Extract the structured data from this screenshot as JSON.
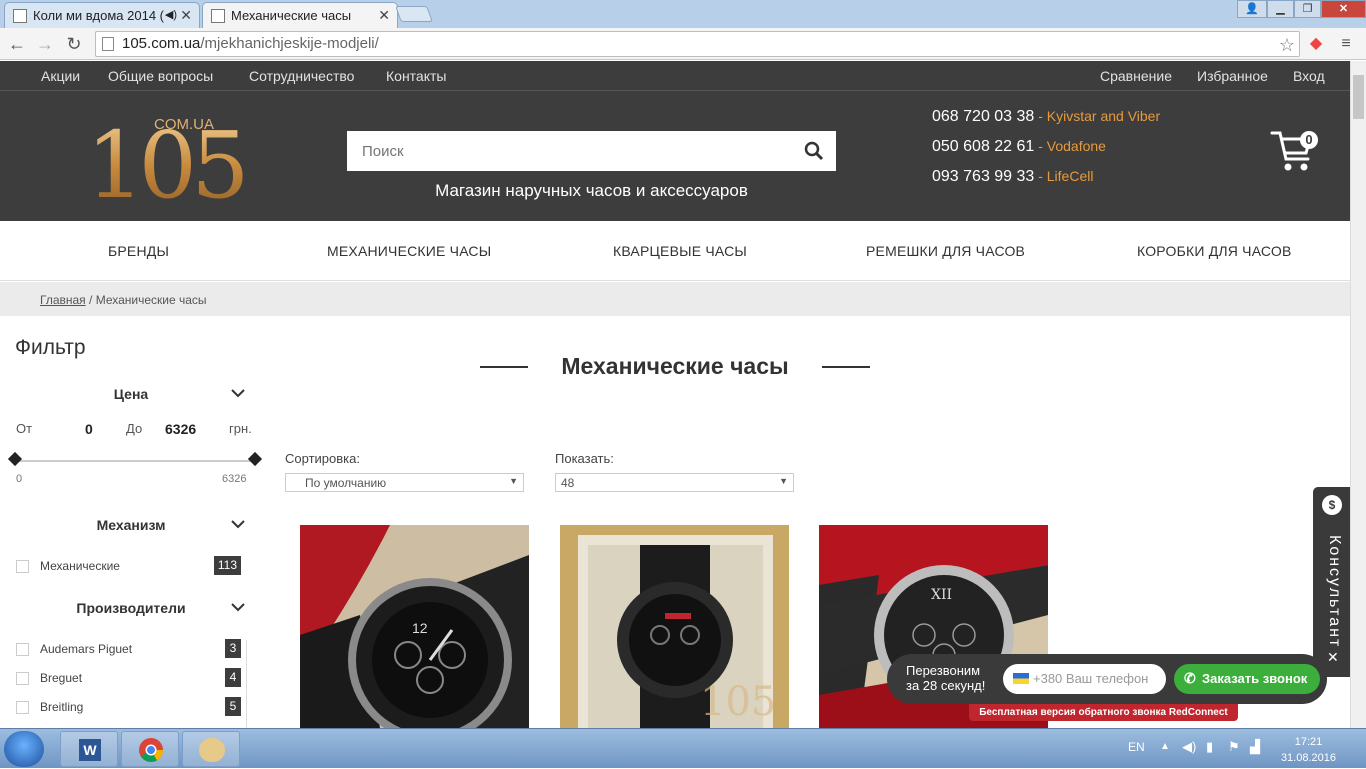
{
  "browser": {
    "tabs": [
      {
        "title": "Коли ми вдома 2014 ("
      },
      {
        "title": "Механические часы"
      }
    ],
    "url_domain": "105.com.ua",
    "url_path": "/mjekhanichjeskije-modjeli/"
  },
  "topnav": {
    "left": [
      "Акции",
      "Общие вопросы",
      "Сотрудничество",
      "Контакты"
    ],
    "right": [
      "Сравнение",
      "Избранное",
      "Вход"
    ]
  },
  "header": {
    "logo_text": "105",
    "logo_sub": "COM.UA",
    "search_placeholder": "Поиск",
    "tagline": "Магазин наручных часов и аксессуаров",
    "phones": [
      {
        "number": "068 720 03 38",
        "operator": " - Kyivstar and Viber"
      },
      {
        "number": "050 608 22 61",
        "operator": " - Vodafone"
      },
      {
        "number": "093 763 99 33",
        "operator": " - LifeCell"
      }
    ],
    "cart_count": "0"
  },
  "mainnav": [
    "БРЕНДЫ",
    "МЕХАНИЧЕСКИЕ ЧАСЫ",
    "КВАРЦЕВЫЕ ЧАСЫ",
    "РЕМЕШКИ ДЛЯ ЧАСОВ",
    "КОРОБКИ ДЛЯ ЧАСОВ"
  ],
  "breadcrumb": {
    "home": "Главная",
    "sep": " / ",
    "current": "Механические часы"
  },
  "filter": {
    "title": "Фильтр",
    "price": {
      "heading": "Цена",
      "from_label": "От",
      "from_value": "0",
      "to_label": "До",
      "to_value": "6326",
      "currency": "грн.",
      "min": "0",
      "max": "6326"
    },
    "mechanism": {
      "heading": "Механизм",
      "items": [
        {
          "label": "Механические",
          "count": "113"
        }
      ]
    },
    "brands": {
      "heading": "Производители",
      "items": [
        {
          "label": "Audemars Piguet",
          "count": "3"
        },
        {
          "label": "Breguet",
          "count": "4"
        },
        {
          "label": "Breitling",
          "count": "5"
        }
      ]
    }
  },
  "catalog": {
    "title": "Механические часы",
    "sort_label": "Сортировка:",
    "sort_value": "По умолчанию",
    "show_label": "Показать:",
    "show_value": "48"
  },
  "widgets": {
    "consultant": "Консультант",
    "callback_text_1": "Перезвоним",
    "callback_text_2": "за 28 секунд!",
    "phone_placeholder": "+380 Ваш телефон",
    "order_button": "Заказать звонок",
    "redconnect": "Бесплатная версия обратного звонка RedConnect"
  },
  "taskbar": {
    "lang": "EN",
    "time": "17:21",
    "date": "31.08.2016"
  }
}
